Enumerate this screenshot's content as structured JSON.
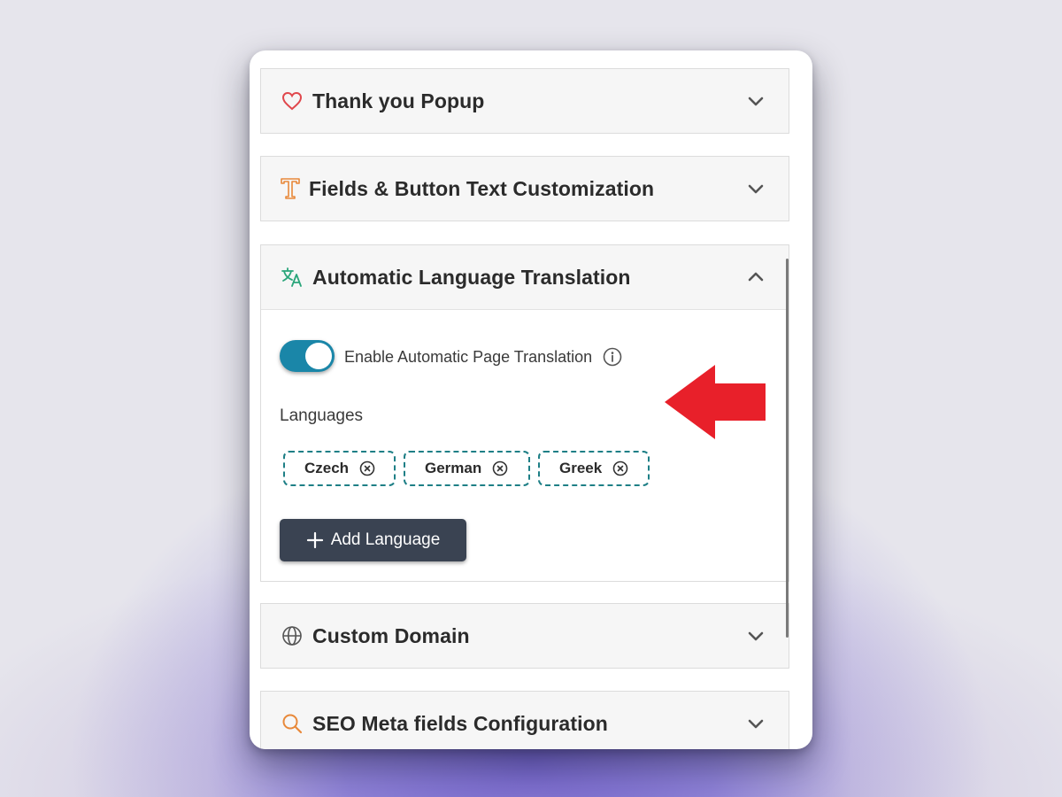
{
  "sections": [
    {
      "title": "Thank you Popup",
      "icon": "heart-icon",
      "state": "collapsed"
    },
    {
      "title": "Fields & Button Text Customization",
      "icon": "text-format-icon",
      "state": "collapsed"
    },
    {
      "title": "Automatic Language Translation",
      "icon": "translate-icon",
      "state": "expanded"
    },
    {
      "title": "Custom Domain",
      "icon": "globe-icon",
      "state": "collapsed"
    },
    {
      "title": "SEO Meta fields Configuration",
      "icon": "search-icon",
      "state": "collapsed"
    }
  ],
  "translation": {
    "toggle_label": "Enable Automatic Page Translation",
    "toggle_on": true,
    "languages_label": "Languages",
    "languages": [
      "Czech",
      "German",
      "Greek"
    ],
    "add_button_label": "Add Language"
  },
  "colors": {
    "toggle": "#1a86a8",
    "chip_border": "#1e7f86",
    "add_button": "#3a4352",
    "arrow": "#e8202a",
    "heart": "#e0474c",
    "text_icon": "#e8893a",
    "translate_icon": "#2aa57a",
    "search_icon": "#e8893a"
  }
}
